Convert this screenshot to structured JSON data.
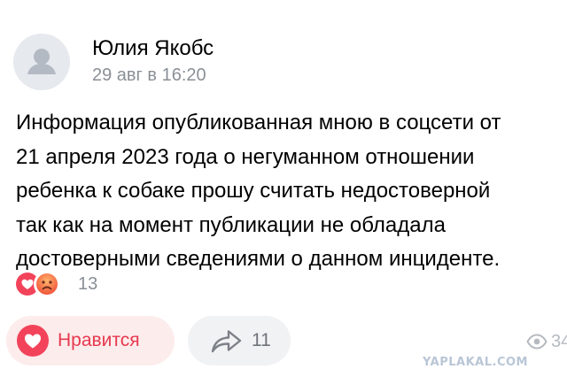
{
  "post": {
    "author_name": "Юлия Якобс",
    "timestamp": "29 авг в 16:20",
    "text_lines": [
      "Информация опубликованная мною в соцсети от",
      "21 апреля 2023 года о негуманном отношении",
      "ребенка к собаке прошу считать недостоверной",
      "так как на момент публикации не обладала",
      "достоверными сведениями о данном инциденте."
    ]
  },
  "reactions": {
    "icons": [
      "heart-icon",
      "sad-face-icon"
    ],
    "count": "13"
  },
  "actions": {
    "like_label": "Нравится",
    "share_count": "11",
    "views_count": "34"
  },
  "watermark": "YAPLAKAL.COM",
  "colors": {
    "accent_red": "#f2435a",
    "like_bg": "#fdecec",
    "share_bg": "#f1f2f4",
    "secondary_text": "#8a8f96",
    "watermark": "#b9c6d6"
  }
}
